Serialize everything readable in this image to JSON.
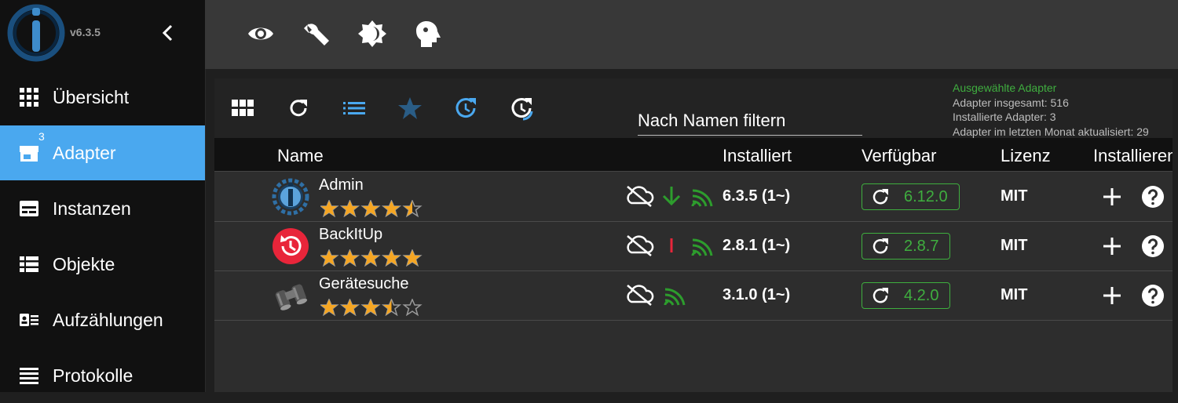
{
  "app": {
    "version": "v6.3.5"
  },
  "sidebar": {
    "items": [
      {
        "label": "Übersicht",
        "icon": "grid-icon"
      },
      {
        "label": "Adapter",
        "icon": "store-icon",
        "badge": "3",
        "active": true
      },
      {
        "label": "Instanzen",
        "icon": "instances-icon"
      },
      {
        "label": "Objekte",
        "icon": "list-icon"
      },
      {
        "label": "Aufzählungen",
        "icon": "id-card-icon"
      },
      {
        "label": "Protokolle",
        "icon": "menu-lines-icon"
      }
    ]
  },
  "topbar": {
    "icons": [
      "eye-icon",
      "wrench-icon",
      "brightness-icon",
      "expert-mode-icon"
    ]
  },
  "toolbar": {
    "icons": [
      "tile-view-icon",
      "refresh-icon",
      "list-view-icon",
      "star-icon",
      "update-icon",
      "update-all-icon"
    ],
    "filter_placeholder": "Nach Namen filtern"
  },
  "stats": {
    "selected": "Ausgewählte Adapter",
    "total": "Adapter insgesamt: 516",
    "installed": "Installierte Adapter: 3",
    "updated_last_month": "Adapter im letzten Monat aktualisiert: 29"
  },
  "table": {
    "headers": {
      "name": "Name",
      "installed": "Installiert",
      "available": "Verfügbar",
      "license": "Lizenz",
      "install": "Installieren"
    },
    "rows": [
      {
        "name": "Admin",
        "rating": 4.5,
        "installed": "6.3.5 (1~)",
        "available": "6.12.0",
        "license": "MIT",
        "icon": "admin-logo-icon"
      },
      {
        "name": "BackItUp",
        "rating": 5,
        "installed": "2.8.1 (1~)",
        "available": "2.8.7",
        "license": "MIT",
        "icon": "backitup-logo-icon"
      },
      {
        "name": "Gerätesuche",
        "rating": 3.5,
        "installed": "3.1.0 (1~)",
        "available": "4.2.0",
        "license": "MIT",
        "icon": "binoculars-icon"
      }
    ]
  },
  "colors": {
    "accent": "#4aa8ef",
    "green": "#3fae3f",
    "star": "#f5a623",
    "red": "#e8253a"
  }
}
